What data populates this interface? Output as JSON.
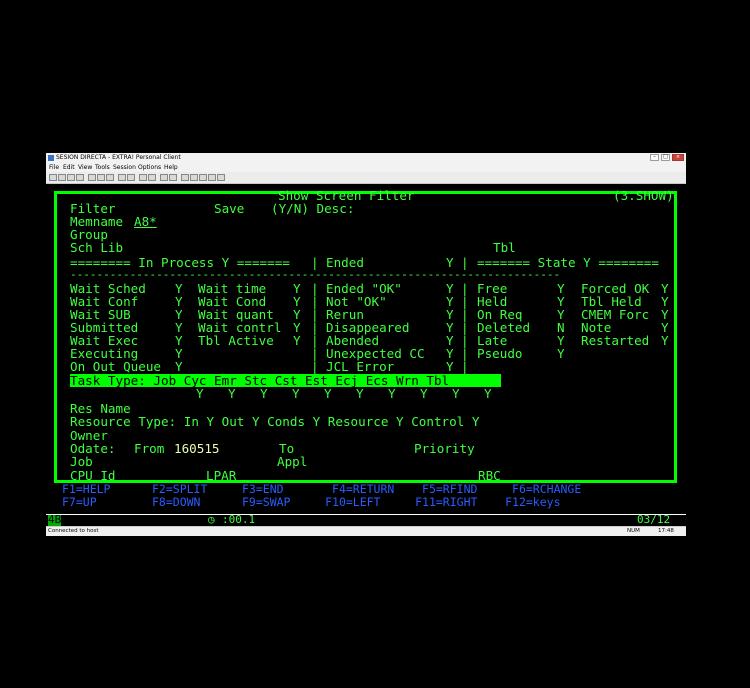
{
  "window": {
    "title": "SESION DIRECTA - EXTRA! Personal Client",
    "menu": [
      "File",
      "Edit",
      "View",
      "Tools",
      "Session",
      "Options",
      "Help"
    ]
  },
  "terminal": {
    "header_title": "Show Screen Filter",
    "header_id": "(3.SHOW)",
    "filter_label": "Filter",
    "save_label": "Save",
    "save_hint": "(Y/N) Desc:",
    "memname_label": "Memname",
    "memname_value": "A8*",
    "group_label": "Group",
    "schlib_label": "Sch Lib",
    "tbl_label": "Tbl",
    "sections": {
      "in_process": "======== In Process Y =======",
      "ended": "Ended",
      "ended_flag": "Y",
      "state": "======= State Y ========"
    },
    "separator": "--------------------------------------------------------------------------",
    "in_process_items": [
      {
        "a": "Wait Sched",
        "av": "Y",
        "b": "Wait time",
        "bv": "Y"
      },
      {
        "a": "Wait Conf",
        "av": "Y",
        "b": "Wait Cond",
        "bv": "Y"
      },
      {
        "a": "Wait SUB",
        "av": "Y",
        "b": "Wait quant",
        "bv": "Y"
      },
      {
        "a": "Submitted",
        "av": "Y",
        "b": "Wait contrl",
        "bv": "Y"
      },
      {
        "a": "Wait Exec",
        "av": "Y",
        "b": "Tbl Active",
        "bv": "Y"
      },
      {
        "a": "Executing",
        "av": "Y",
        "b": "",
        "bv": ""
      },
      {
        "a": "On Out Queue",
        "av": "Y",
        "b": "",
        "bv": ""
      }
    ],
    "ended_items": [
      {
        "l": "Ended \"OK\"",
        "v": "Y"
      },
      {
        "l": "Not \"OK\"",
        "v": "Y"
      },
      {
        "l": "Rerun",
        "v": "Y"
      },
      {
        "l": "Disappeared",
        "v": "Y"
      },
      {
        "l": "Abended",
        "v": "Y"
      },
      {
        "l": "Unexpected CC",
        "v": "Y"
      },
      {
        "l": "JCL Error",
        "v": "Y"
      }
    ],
    "state_items": [
      {
        "a": "Free",
        "av": "Y",
        "b": "Forced OK",
        "bv": "Y"
      },
      {
        "a": "Held",
        "av": "Y",
        "b": "Tbl Held",
        "bv": "Y"
      },
      {
        "a": "On Req",
        "av": "Y",
        "b": "CMEM Forc",
        "bv": "Y"
      },
      {
        "a": "Deleted",
        "av": "N",
        "b": "Note",
        "bv": "Y"
      },
      {
        "a": "Late",
        "av": "Y",
        "b": "Restarted",
        "bv": "Y"
      },
      {
        "a": "Pseudo",
        "av": "Y",
        "b": "",
        "bv": ""
      }
    ],
    "task_type_label": "Task Type: Job Cyc Emr Stc Cst Est Ecj Ecs Wrn Tbl",
    "task_type_values": [
      "Y",
      "Y",
      "Y",
      "Y",
      "Y",
      "Y",
      "Y",
      "Y",
      "Y",
      "Y"
    ],
    "res_name_label": "Res Name",
    "resource_type_line": "Resource Type: In Y Out Y Conds Y Resource Y Control Y",
    "owner_label": "Owner",
    "odate_label": "Odate:",
    "from_label": "From",
    "from_value": "160515",
    "to_label": "To",
    "priority_label": "Priority",
    "job_label": "Job",
    "appl_label": "Appl",
    "cpuid_label": "CPU Id",
    "lpar_label": "LPAR",
    "rbc_label": "RBC",
    "fkeys_row1": "F1=HELP      F2=SPLIT     F3=END       F4=RETURN    F5=RFIND     F6=RCHANGE",
    "fkeys_row2": "F7=UP        F8=DOWN      F9=SWAP     F10=LEFT     F11=RIGHT    F12=keys"
  },
  "status": {
    "session": "4B",
    "clock": ":00.1",
    "cursor_pos": "03/12"
  },
  "bottombar": {
    "connection": "Connected to host",
    "num": "NUM",
    "time": "17:48"
  },
  "colors": {
    "terminal_green": "#40ff40",
    "frame_green": "#00ff00",
    "fkey_blue": "#2a5cff"
  }
}
